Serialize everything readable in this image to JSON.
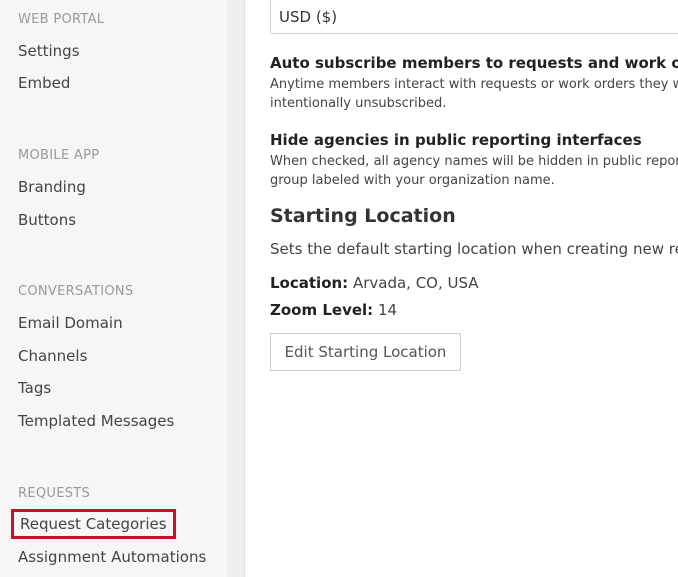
{
  "sidebar": {
    "sections": [
      {
        "heading": "WEB PORTAL",
        "items": [
          "Settings",
          "Embed"
        ]
      },
      {
        "heading": "MOBILE APP",
        "items": [
          "Branding",
          "Buttons"
        ]
      },
      {
        "heading": "CONVERSATIONS",
        "items": [
          "Email Domain",
          "Channels",
          "Tags",
          "Templated Messages"
        ]
      },
      {
        "heading": "REQUESTS",
        "items": [
          "Request Categories",
          "Assignment Automations"
        ]
      }
    ],
    "highlighted_item": "Request Categories",
    "highlight_color": "#c8102e"
  },
  "main": {
    "currency_value": "USD ($)",
    "auto_subscribe": {
      "title": "Auto subscribe members to requests and work orders",
      "desc_line1": "Anytime members interact with requests or work orders they will be",
      "desc_line2": "intentionally unsubscribed."
    },
    "hide_agencies": {
      "title": "Hide agencies in public reporting interfaces",
      "desc_line1": "When checked, all agency names will be hidden in public reporting i",
      "desc_line2": "group labeled with your organization name."
    },
    "starting_location": {
      "heading": "Starting Location",
      "desc": "Sets the default starting location when creating new reque",
      "location_label": "Location:",
      "location_value": "Arvada, CO, USA",
      "zoom_label": "Zoom Level:",
      "zoom_value": "14",
      "edit_button": "Edit Starting Location"
    }
  }
}
